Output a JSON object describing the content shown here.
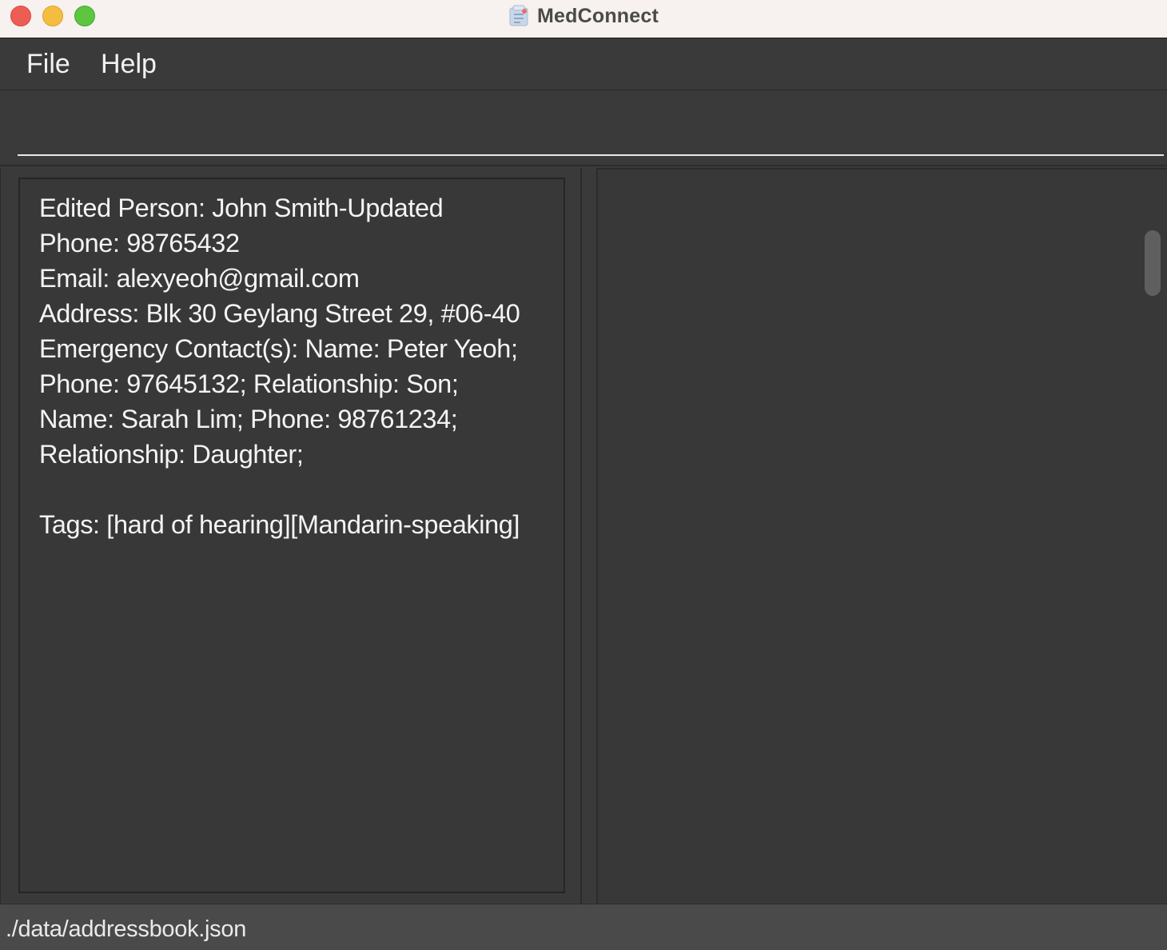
{
  "window": {
    "title": "MedConnect"
  },
  "menu": {
    "items": [
      "File",
      "Help"
    ]
  },
  "command_box": {
    "value": "",
    "placeholder": ""
  },
  "result_display": {
    "lines": [
      "Edited Person: John Smith-Updated",
      "Phone: 98765432",
      "Email: alexyeoh@gmail.com",
      "Address: Blk 30 Geylang Street 29, #06-40",
      "Emergency Contact(s): Name: Peter Yeoh;",
      "Phone: 97645132; Relationship: Son;",
      "Name: Sarah Lim; Phone: 98761234;",
      "Relationship: Daughter;",
      "",
      "Tags: [hard of hearing][Mandarin-speaking]"
    ]
  },
  "status_bar": {
    "path": "./data/addressbook.json"
  },
  "colors": {
    "background": "#3a3a3a",
    "titlebar": "#f7f1ef",
    "text": "#f4f4f4",
    "statusbar": "#4a4a4a"
  },
  "icons": {
    "app": "medconnect-app-icon",
    "close": "close-window-icon",
    "minimize": "minimize-window-icon",
    "maximize": "maximize-window-icon"
  }
}
